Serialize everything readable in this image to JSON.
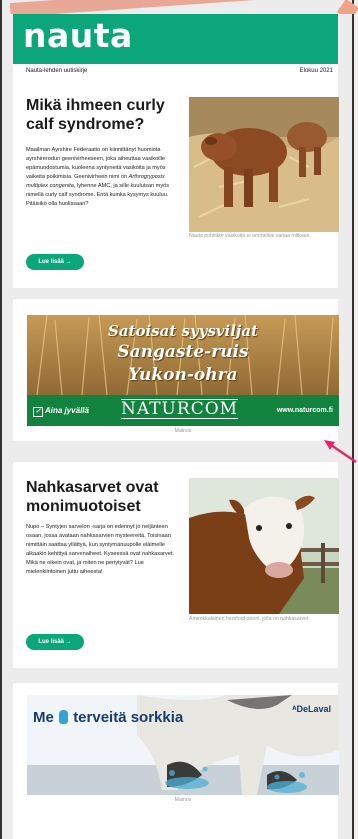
{
  "brand": {
    "logo": "nauta",
    "color": "#0ba77b"
  },
  "meta": {
    "left": "Nauta-lehden uutiskirje",
    "right": "Elokuu 2021"
  },
  "article1": {
    "title": "Mikä ihmeen curly calf syndrome?",
    "body": "Maailman Ayrshire Federaatio on kiinnittänyt huomiota ayrshirerodun geenivirheeseen, joka aiheuttaa vasikoille epämuodostumia, kuoleena syntyneitä vasikoita ja myös vaikeita poikimisia. Geenivirheen nimi on",
    "body_italic": "Arthrogryposis multiplex congenita,",
    "body_end": "lyhenne AMC, ja sille kuuluisan myös nimellä curly calf syndrome. Entä kuinka kysymys kuuluu. Pitäisikö olla huolissaan?",
    "button": "Lue lisää →",
    "caption": "Nauta pohtiikte vasikoita ei ommelkai vanaa mitkaan."
  },
  "ad1": {
    "line1": "Satoisat syysviljat",
    "line2": "Sangaste-ruis",
    "line3": "Yukon-ohra",
    "tagline": "Aina jyvällä",
    "brand": "NATURCOM",
    "url": "www.naturcom.fi",
    "label": "Mainos"
  },
  "article2": {
    "title": "Nahkasarvet ovat monimuotoiset",
    "body": "Nupo – Syntyjen sarvelon -sarja on edennyt jo neljänteen osaan, jossa avataan nahkasarvien mysteereitä. Toisinaan nimittäin saattaa yllättyä, kun syntymänuupolle eläimelle alkaakin kehittyä sarvenalheet. Kyseessä ovat nahkasarvet. Mikä ne oikein ovat, ja miten ne periytyvät? Lue mielenkiintoinen juttu aiheesta!",
    "button": "Lue lisää →",
    "caption": "Amerikkalainen hereford-sonni, jolla on nahkasarvet"
  },
  "ad2": {
    "headline_a": "Me",
    "headline_b": "terveitä sorkkia",
    "brand": "DeLaval",
    "label": "Mainos"
  }
}
